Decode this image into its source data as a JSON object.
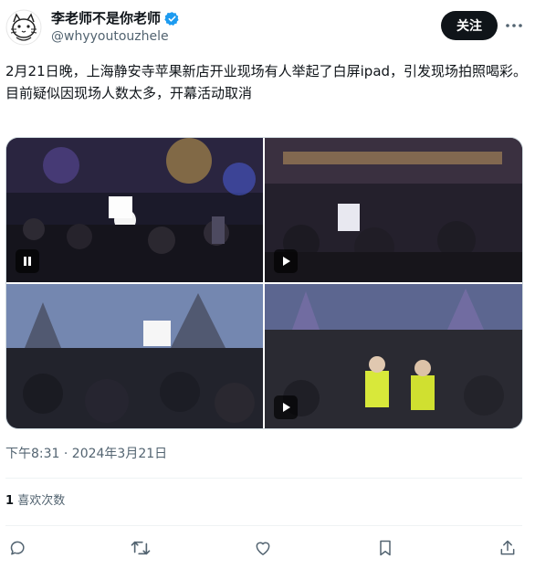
{
  "user": {
    "display_name": "李老师不是你老师",
    "handle": "@whyyoutouzhele",
    "verified": true,
    "avatar_icon": "cat-doodle-avatar"
  },
  "header": {
    "follow_label": "关注",
    "more_icon": "more-dots-icon"
  },
  "tweet": {
    "text": "2月21日晚，上海静安寺苹果新店开业现场有人举起了白屏ipad，引发现场拍照喝彩。\n目前疑似因现场人数太多，开幕活动取消"
  },
  "media": [
    {
      "kind": "video",
      "state": "playing",
      "control_icon": "pause-icon"
    },
    {
      "kind": "video",
      "state": "paused",
      "control_icon": "play-icon"
    },
    {
      "kind": "image"
    },
    {
      "kind": "video",
      "state": "paused",
      "control_icon": "play-icon"
    }
  ],
  "meta": {
    "timestamp": "下午8:31 · 2024年3月21日"
  },
  "stats": {
    "likes_count": "1",
    "likes_label": "喜欢次数"
  },
  "actions": [
    {
      "icon": "reply-icon"
    },
    {
      "icon": "retweet-icon"
    },
    {
      "icon": "like-icon"
    },
    {
      "icon": "bookmark-icon"
    },
    {
      "icon": "share-icon"
    }
  ],
  "colors": {
    "text_primary": "#0f1419",
    "text_secondary": "#536471",
    "verified_blue": "#1d9bf0",
    "divider": "#eff3f4"
  }
}
